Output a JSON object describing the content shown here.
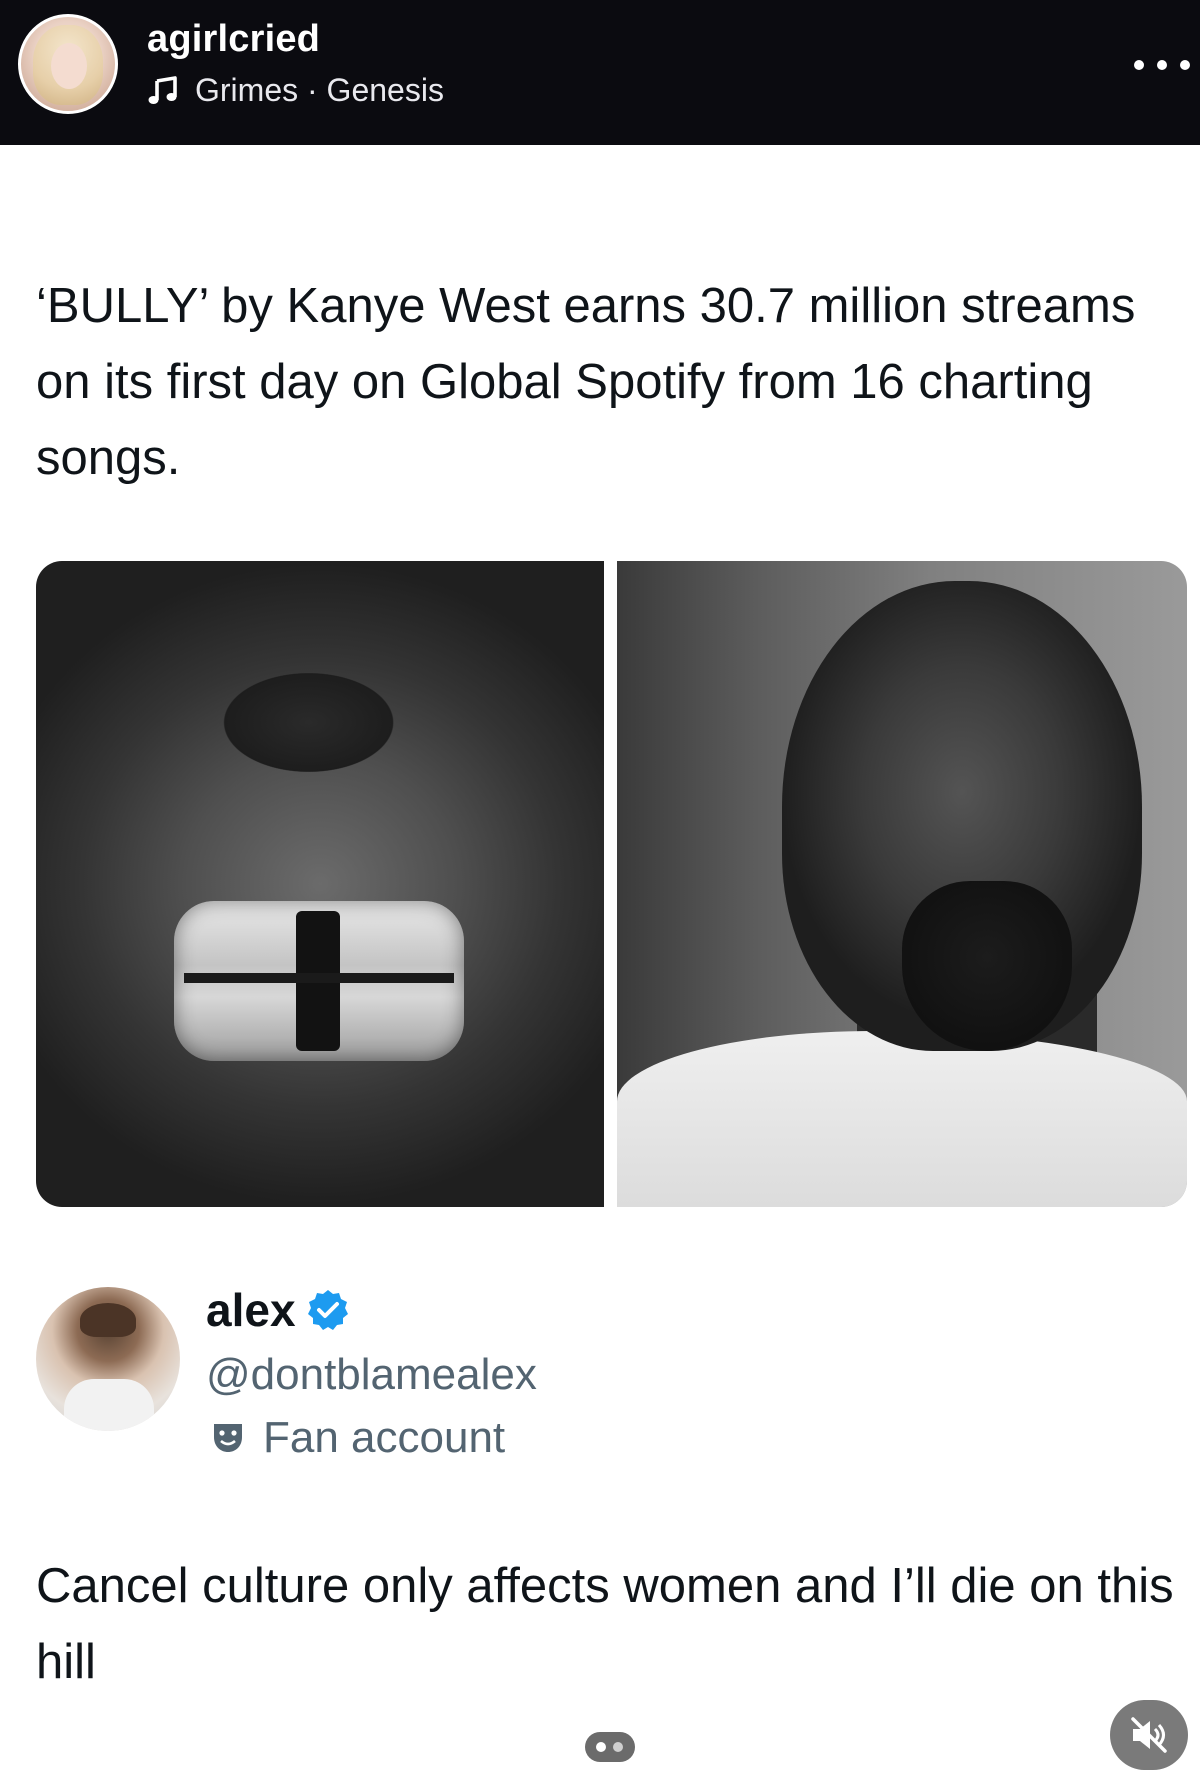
{
  "story": {
    "username": "agirlcried",
    "music": "Grimes · Genesis",
    "more_icon": "more-horizontal-icon"
  },
  "tweet": {
    "text": "‘BULLY’ by Kanye West earns 30.7 million streams on its first day on Global Spotify from 16 charting songs."
  },
  "quote": {
    "author_name": "alex",
    "handle": "@dontblamealex",
    "label": "Fan account",
    "text": "Cancel culture only affects women and I’ll die on this hill"
  },
  "colors": {
    "header_bg": "#0b0b10",
    "verified_blue": "#1d9bf0",
    "text_primary": "#0f1419",
    "text_secondary": "#536471"
  }
}
